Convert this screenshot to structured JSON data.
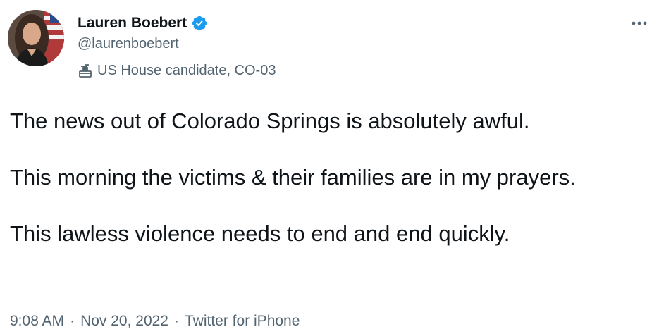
{
  "author": {
    "display_name": "Lauren Boebert",
    "handle": "@laurenboebert",
    "affiliation_label": "US House candidate, CO-03",
    "verified": true,
    "verified_icon": "verified-badge-icon",
    "affiliation_icon": "ballot-box-icon"
  },
  "tweet": {
    "paragraphs": [
      "The news out of Colorado Springs is absolutely awful.",
      "This morning the victims & their families are in my prayers.",
      "This lawless violence needs to end and end quickly."
    ]
  },
  "meta": {
    "time": "9:08 AM",
    "date": "Nov 20, 2022",
    "source": "Twitter for iPhone",
    "separator": "·"
  },
  "colors": {
    "text": "#0f1419",
    "secondary": "#536471",
    "verified_blue": "#1d9bf0"
  }
}
